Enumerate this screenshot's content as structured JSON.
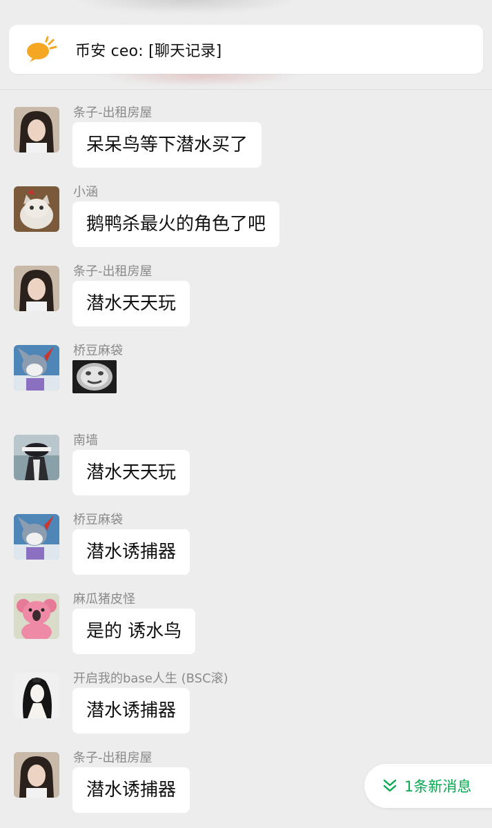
{
  "announcement": {
    "text": "币安 ceo: [聊天记录]"
  },
  "messages": [
    {
      "sender": "条子-出租房屋",
      "text": "呆呆鸟等下潜水买了"
    },
    {
      "sender": "小涵",
      "text": "鹅鸭杀最火的角色了吧"
    },
    {
      "sender": "条子-出租房屋",
      "text": "潜水天天玩"
    },
    {
      "sender": "桥豆麻袋",
      "text": ""
    },
    {
      "sender": "南墙",
      "text": "潜水天天玩"
    },
    {
      "sender": "桥豆麻袋",
      "text": "潜水诱捕器"
    },
    {
      "sender": "麻瓜猪皮怪",
      "text": "是的 诱水鸟"
    },
    {
      "sender": "开启我的base人生 (BSC滚)",
      "text": "潜水诱捕器"
    },
    {
      "sender": "条子-出租房屋",
      "text": "潜水诱捕器"
    }
  ],
  "new_message_badge": {
    "label": "1条新消息"
  },
  "colors": {
    "background": "#ededed",
    "bubble": "#ffffff",
    "accent": "#07a84f"
  },
  "icons": {
    "announcement": "megaphone-icon",
    "new_message": "double-chevron-down-icon"
  }
}
